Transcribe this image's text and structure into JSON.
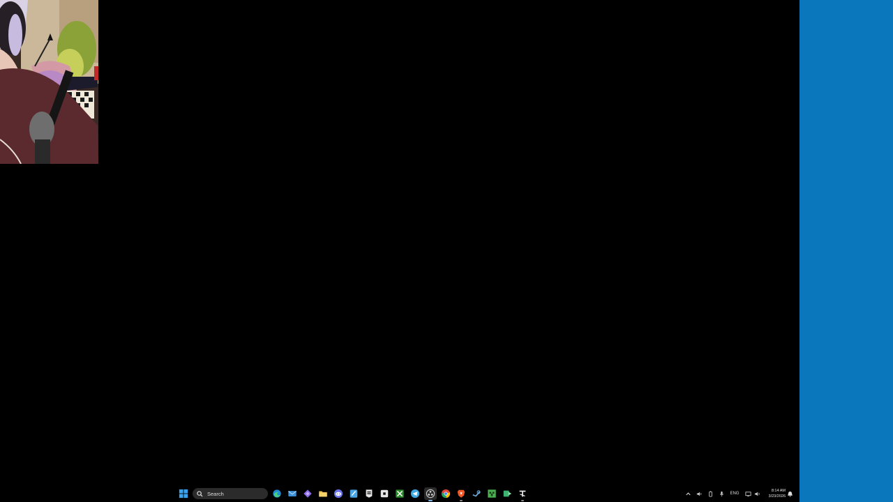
{
  "desktop": {
    "background": "#000000"
  },
  "side_panel": {
    "color": "#0a77bd"
  },
  "webcam": {
    "description_icon": "webcam-overlay"
  },
  "taskbar": {
    "search": {
      "label": "Search",
      "icon": "search-icon"
    },
    "pinned": [
      {
        "name": "start-button",
        "icon": "windows-logo-icon",
        "color": "#3aa0f0"
      },
      {
        "name": "edge",
        "icon": "edge-icon",
        "color": "#2fb3e8"
      },
      {
        "name": "mail",
        "icon": "mail-icon",
        "color": "#3a8fd8"
      },
      {
        "name": "copilot",
        "icon": "copilot-icon",
        "color": "#8d6bea"
      },
      {
        "name": "file-explorer",
        "icon": "folder-icon",
        "color": "#f2c14e"
      },
      {
        "name": "discord",
        "icon": "discord-icon",
        "color": "#6b73e8"
      },
      {
        "name": "notepad",
        "icon": "notepad-icon",
        "color": "#49a5e6"
      },
      {
        "name": "epic-games",
        "icon": "epic-games-icon",
        "color": "#e6e6e6"
      },
      {
        "name": "roblox",
        "icon": "roblox-icon",
        "color": "#e6e6e6"
      },
      {
        "name": "xbox",
        "icon": "xbox-icon",
        "color": "#4ab84a"
      },
      {
        "name": "telegram",
        "icon": "telegram-icon",
        "color": "#3ea6e0"
      },
      {
        "name": "obs",
        "icon": "obs-icon",
        "color": "#cfcfcf"
      },
      {
        "name": "chrome",
        "icon": "chrome-icon",
        "color": "#e0463a"
      },
      {
        "name": "brave",
        "icon": "brave-icon",
        "color": "#f05a28"
      },
      {
        "name": "steam",
        "icon": "steam-icon",
        "color": "#6ea9d8"
      },
      {
        "name": "minecraft",
        "icon": "minecraft-icon",
        "color": "#4caf50"
      },
      {
        "name": "game-launcher",
        "icon": "game-launcher-icon",
        "color": "#3cb371"
      },
      {
        "name": "tools-app",
        "icon": "tools-icon",
        "color": "#e6e6e6"
      }
    ]
  },
  "tray": {
    "chevron_icon": "chevron-up-icon",
    "language": "ENG",
    "time": "8:14 AM",
    "date": "3/23/2026"
  }
}
